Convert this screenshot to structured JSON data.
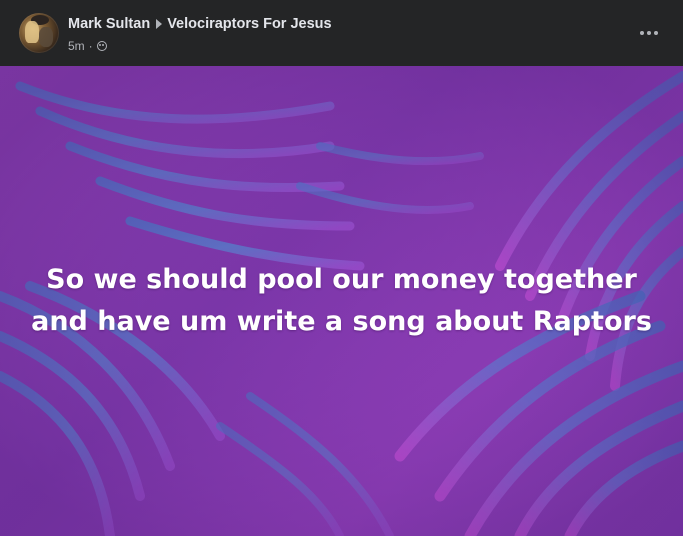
{
  "post": {
    "author": "Mark Sultan",
    "group": "Velociraptors For Jesus",
    "timestamp": "5m",
    "separator": "·",
    "privacy_icon": "group-privacy-icon",
    "more_icon": "more-options-icon",
    "body_text": "So we should pool our money together and have um write a song about Raptors"
  },
  "colors": {
    "header_bg": "#242526",
    "name_text": "#e4e6eb",
    "meta_text": "#b0b3b8",
    "card_bg": "#8a3fb0",
    "leaf_blue": "#3f7fc4",
    "leaf_purple": "#b84fd8"
  }
}
